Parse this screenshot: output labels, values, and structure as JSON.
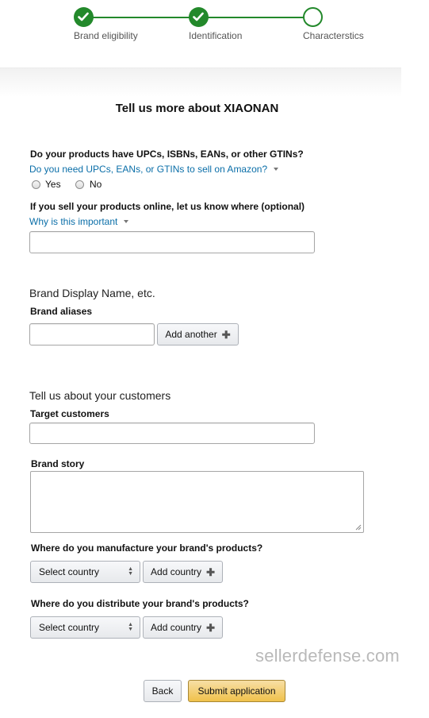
{
  "stepper": {
    "steps": [
      {
        "label": "Brand eligibility",
        "status": "complete"
      },
      {
        "label": "Identification",
        "status": "complete"
      },
      {
        "label": "Characterstics",
        "status": "current"
      }
    ],
    "accent_color": "#23892b"
  },
  "page_title": "Tell us more about XIAONAN",
  "gtin": {
    "question": "Do your products have UPCs, ISBNs, EANs, or other GTINs?",
    "help_link": "Do you need UPCs, EANs, or GTINs to sell on Amazon?",
    "options": [
      "Yes",
      "No"
    ]
  },
  "online": {
    "question": "If you sell your products online, let us know where (optional)",
    "help_link": "Why is this important",
    "value": ""
  },
  "brand_display": {
    "heading": "Brand Display Name, etc.",
    "aliases_label": "Brand aliases",
    "alias_value": "",
    "add_another_label": "Add another"
  },
  "customers": {
    "heading": "Tell us about your customers",
    "target_label": "Target customers",
    "target_value": "",
    "story_label": "Brand story",
    "story_value": ""
  },
  "manufacture": {
    "question": "Where do you manufacture your brand's products?",
    "select_value": "Select country",
    "add_label": "Add country"
  },
  "distribute": {
    "question": "Where do you distribute your brand's products?",
    "select_value": "Select country",
    "add_label": "Add country"
  },
  "watermark": "sellerdefense.com",
  "actions": {
    "back_label": "Back",
    "submit_label": "Submit application",
    "submit_color": "#f0c14b"
  }
}
